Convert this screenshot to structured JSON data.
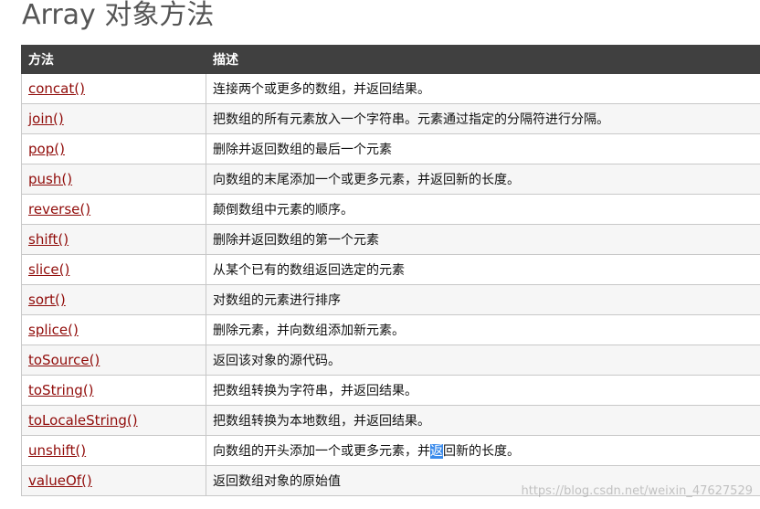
{
  "title": "Array 对象方法",
  "table": {
    "headers": [
      "方法",
      "描述"
    ],
    "rows": [
      {
        "method": "concat()",
        "desc": "连接两个或更多的数组，并返回结果。"
      },
      {
        "method": "join()",
        "desc": "把数组的所有元素放入一个字符串。元素通过指定的分隔符进行分隔。"
      },
      {
        "method": "pop()",
        "desc": "删除并返回数组的最后一个元素"
      },
      {
        "method": "push()",
        "desc": "向数组的末尾添加一个或更多元素，并返回新的长度。"
      },
      {
        "method": "reverse()",
        "desc": "颠倒数组中元素的顺序。"
      },
      {
        "method": "shift()",
        "desc": "删除并返回数组的第一个元素"
      },
      {
        "method": "slice()",
        "desc": "从某个已有的数组返回选定的元素"
      },
      {
        "method": "sort()",
        "desc": "对数组的元素进行排序"
      },
      {
        "method": "splice()",
        "desc": "删除元素，并向数组添加新元素。"
      },
      {
        "method": "toSource()",
        "desc": "返回该对象的源代码。"
      },
      {
        "method": "toString()",
        "desc": "把数组转换为字符串，并返回结果。"
      },
      {
        "method": "toLocaleString()",
        "desc": "把数组转换为本地数组，并返回结果。"
      },
      {
        "method": "unshift()",
        "desc_before": "向数组的开头添加一个或更多元素，并",
        "desc_selected": "返",
        "desc_after": "回新的长度。"
      },
      {
        "method": "valueOf()",
        "desc": "返回数组对象的原始值"
      }
    ]
  },
  "watermark": "https://blog.csdn.net/weixin_47627529",
  "colors": {
    "header_bg": "#404040",
    "link": "#900b09",
    "selection": "#3b8beb"
  }
}
